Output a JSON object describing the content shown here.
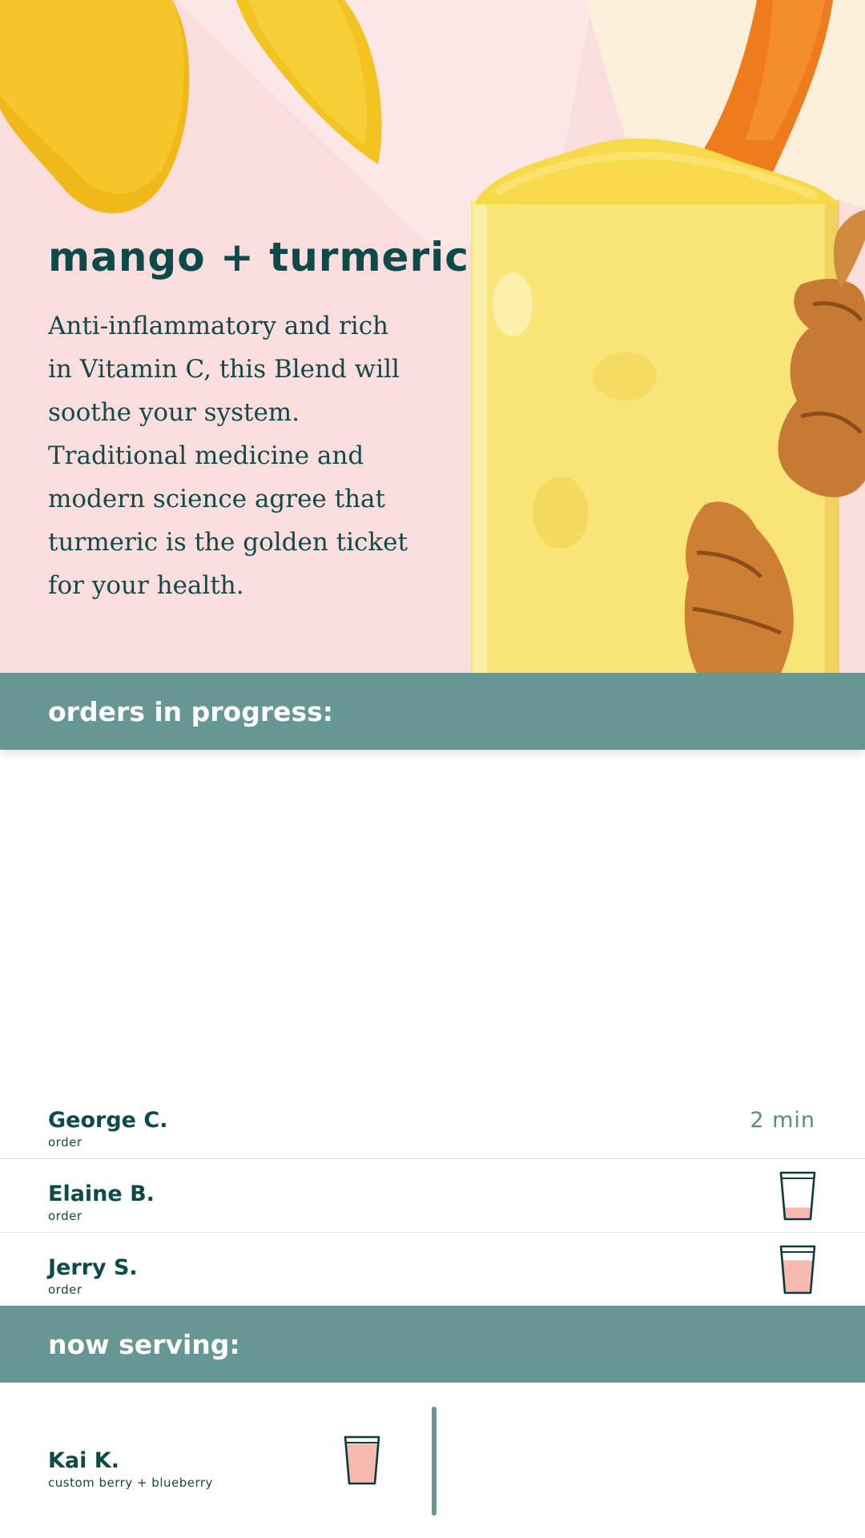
{
  "hero": {
    "title": "mango + turmeric",
    "description": "Anti-inflammatory and rich in Vitamin C, this Blend will soothe your system. Traditional medicine and modern science agree that turmeric is the golden ticket for your health."
  },
  "orders_in_progress": {
    "heading": "orders in progress:",
    "orders": [
      {
        "name": "George C.",
        "label": "order",
        "status_text": "2 min",
        "cup_fill": 0
      },
      {
        "name": "Elaine B.",
        "label": "order",
        "status_text": "",
        "cup_fill": 0.25
      },
      {
        "name": "Jerry S.",
        "label": "order",
        "status_text": "",
        "cup_fill": 0.7
      }
    ]
  },
  "now_serving": {
    "heading": "now serving:",
    "name": "Kai K.",
    "item": "custom berry + blueberry",
    "cup_fill": 0.85
  },
  "colors": {
    "hero_background": "#f9dedd",
    "section_bar": "#679795",
    "primary_text": "#0d4a4a",
    "cup_liquid": "#f6b9b0",
    "cup_outline": "#0d3a3a"
  }
}
